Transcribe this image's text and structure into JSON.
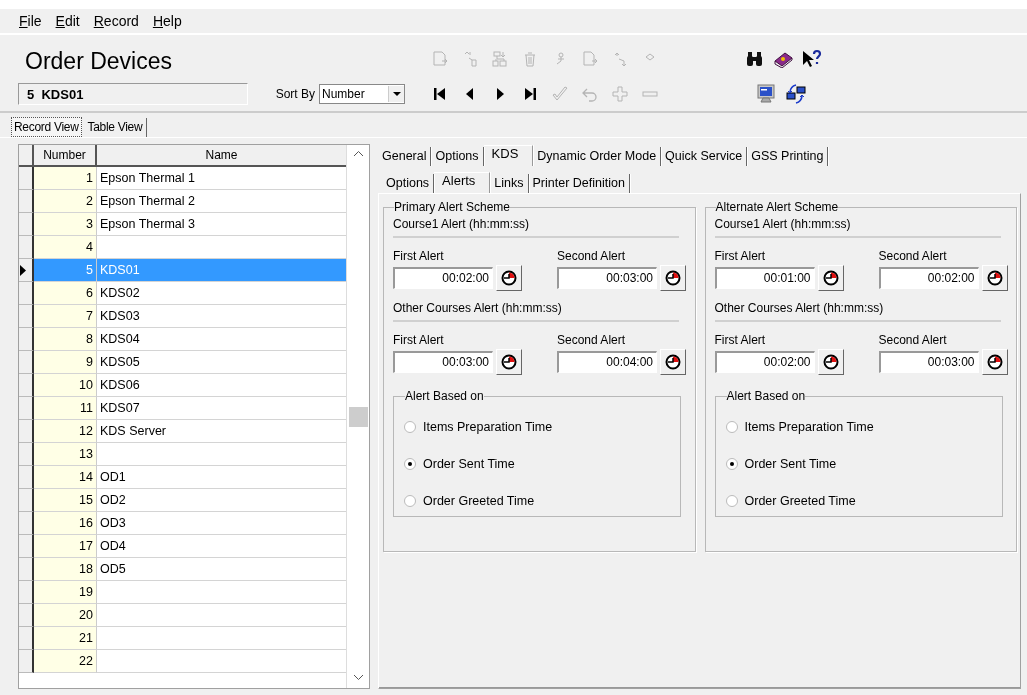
{
  "menu": [
    "File",
    "Edit",
    "Record",
    "Help"
  ],
  "title": "Order Devices",
  "record_field": {
    "value": "5  KDS01"
  },
  "sort_by": {
    "label": "Sort By",
    "value": "Number"
  },
  "toolbar": {
    "record_tools": [
      {
        "disabled": true
      },
      {
        "disabled": true
      },
      {
        "disabled": true
      },
      {
        "disabled": true
      },
      {
        "disabled": true
      },
      {
        "disabled": true
      },
      {
        "disabled": true
      },
      {
        "disabled": true
      }
    ],
    "navigation": [
      {
        "disabled": false
      },
      {
        "disabled": false
      },
      {
        "disabled": false
      },
      {
        "disabled": false
      },
      {
        "disabled": true
      },
      {
        "disabled": true
      },
      {
        "disabled": true
      },
      {
        "disabled": true
      }
    ]
  },
  "view_tabs": [
    {
      "label": "Record View",
      "selected": true
    },
    {
      "label": "Table View",
      "selected": false
    }
  ],
  "table": {
    "columns": [
      "Number",
      "Name"
    ],
    "rows": [
      {
        "number": "1",
        "name": "Epson Thermal 1",
        "selected": false
      },
      {
        "number": "2",
        "name": "Epson Thermal 2",
        "selected": false
      },
      {
        "number": "3",
        "name": "Epson Thermal 3",
        "selected": false
      },
      {
        "number": "4",
        "selected": false
      },
      {
        "number": "5",
        "name": "KDS01",
        "selected": true
      },
      {
        "number": "6",
        "name": "KDS02",
        "selected": false
      },
      {
        "number": "7",
        "name": "KDS03",
        "selected": false
      },
      {
        "number": "8",
        "name": "KDS04",
        "selected": false
      },
      {
        "number": "9",
        "name": "KDS05",
        "selected": false
      },
      {
        "number": "10",
        "name": "KDS06",
        "selected": false
      },
      {
        "number": "11",
        "name": "KDS07",
        "selected": false
      },
      {
        "number": "12",
        "name": "KDS Server",
        "selected": false
      },
      {
        "number": "13",
        "selected": false
      },
      {
        "number": "14",
        "name": "OD1",
        "selected": false
      },
      {
        "number": "15",
        "name": "OD2",
        "selected": false
      },
      {
        "number": "16",
        "name": "OD3",
        "selected": false
      },
      {
        "number": "17",
        "name": "OD4",
        "selected": false
      },
      {
        "number": "18",
        "name": "OD5",
        "selected": false
      },
      {
        "number": "19",
        "selected": false
      },
      {
        "number": "20",
        "selected": false
      },
      {
        "number": "21",
        "selected": false
      },
      {
        "number": "22",
        "selected": false
      }
    ]
  },
  "tabs": [
    {
      "label": "General",
      "selected": false
    },
    {
      "label": "Options",
      "selected": false
    },
    {
      "label": "KDS",
      "selected": true
    },
    {
      "label": "Dynamic Order Mode",
      "selected": false
    },
    {
      "label": "Quick Service",
      "selected": false
    },
    {
      "label": "GSS Printing",
      "selected": false
    }
  ],
  "sub_tabs": [
    {
      "label": "Options",
      "selected": false
    },
    {
      "label": "Alerts",
      "selected": true
    },
    {
      "label": "Links",
      "selected": false
    },
    {
      "label": "Printer Definition",
      "selected": false
    }
  ],
  "alert_schemes": [
    {
      "title": "Primary Alert Scheme",
      "sections": [
        {
          "heading": "Course1 Alert (hh:mm:ss)",
          "fields": [
            {
              "label": "First Alert",
              "value": "00:02:00"
            },
            {
              "label": "Second Alert",
              "value": "00:03:00"
            }
          ]
        },
        {
          "heading": "Other Courses Alert (hh:mm:ss)",
          "fields": [
            {
              "label": "First Alert",
              "value": "00:03:00"
            },
            {
              "label": "Second Alert",
              "value": "00:04:00"
            }
          ]
        }
      ],
      "alert_based_on": {
        "title": "Alert Based on",
        "options": [
          {
            "label": "Items Preparation Time",
            "selected": false
          },
          {
            "label": "Order Sent Time",
            "selected": true
          },
          {
            "label": "Order Greeted Time",
            "selected": false
          }
        ]
      }
    },
    {
      "title": "Alternate Alert Scheme",
      "sections": [
        {
          "heading": "Course1 Alert (hh:mm:ss)",
          "fields": [
            {
              "label": "First Alert",
              "value": "00:01:00"
            },
            {
              "label": "Second Alert",
              "value": "00:02:00"
            }
          ]
        },
        {
          "heading": "Other Courses Alert (hh:mm:ss)",
          "fields": [
            {
              "label": "First Alert",
              "value": "00:02:00"
            },
            {
              "label": "Second Alert",
              "value": "00:03:00"
            }
          ]
        }
      ],
      "alert_based_on": {
        "title": "Alert Based on",
        "options": [
          {
            "label": "Items Preparation Time",
            "selected": false
          },
          {
            "label": "Order Sent Time",
            "selected": true
          },
          {
            "label": "Order Greeted Time",
            "selected": false
          }
        ]
      }
    }
  ]
}
